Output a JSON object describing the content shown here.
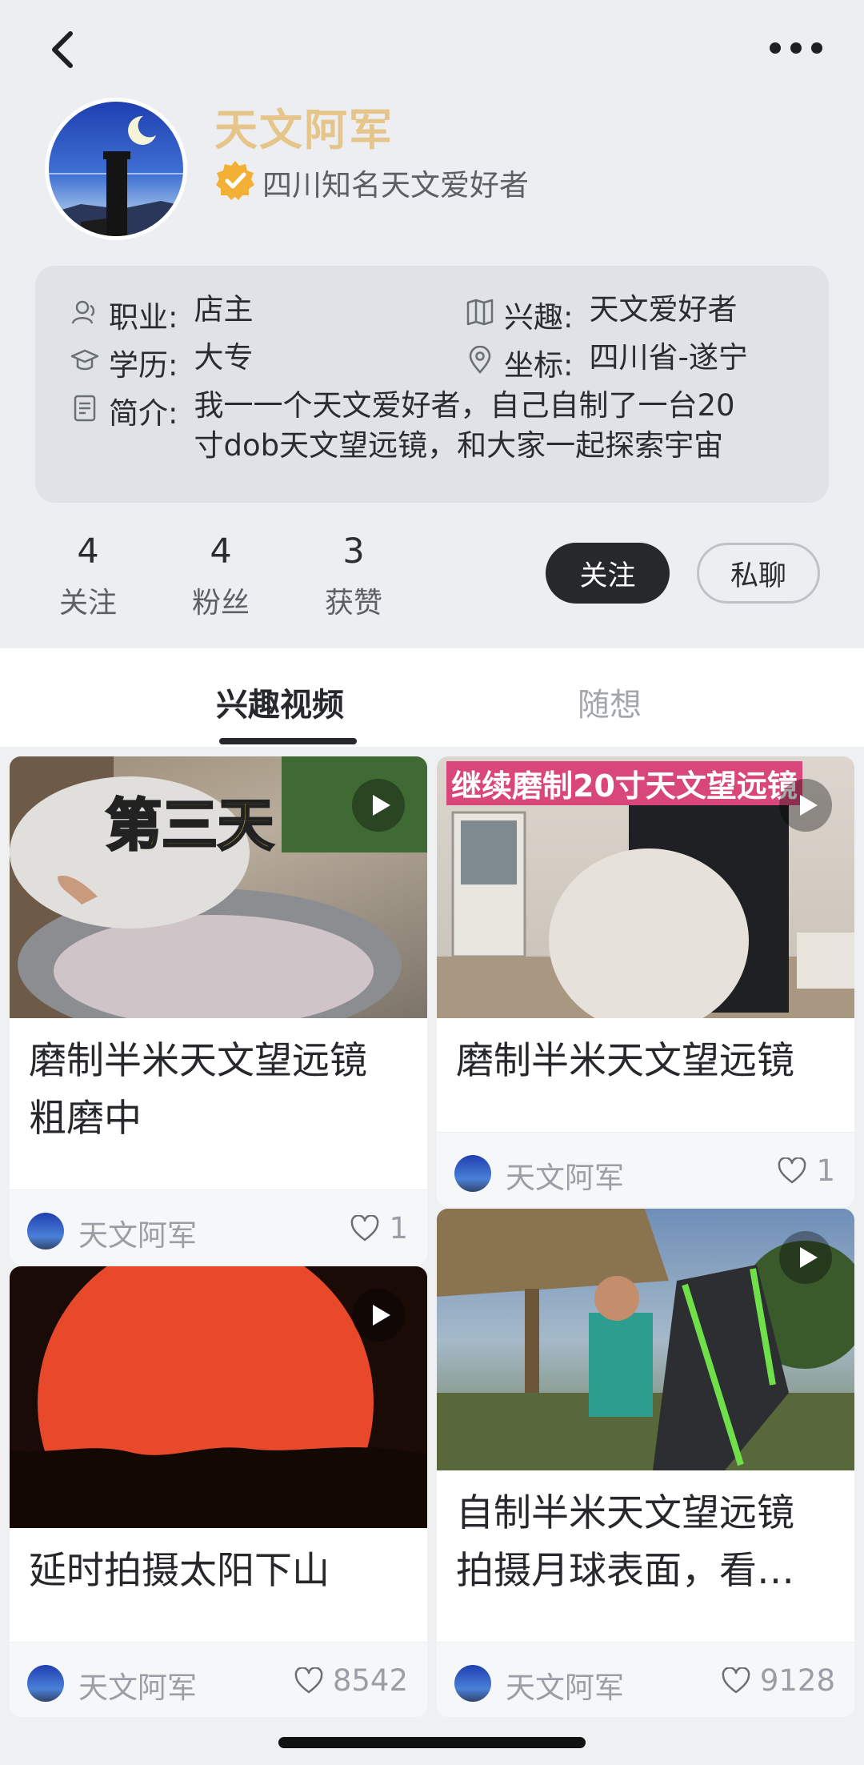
{
  "profile": {
    "name": "天文阿军",
    "verified_text": "四川知名天文爱好者"
  },
  "info": {
    "job_label": "职业:",
    "job_value": "店主",
    "interest_label": "兴趣:",
    "interest_value": "天文爱好者",
    "education_label": "学历:",
    "education_value": "大专",
    "location_label": "坐标:",
    "location_value": "四川省-遂宁",
    "bio_label": "简介:",
    "bio_line1": "我一一个天文爱好者，自己自制了一台20",
    "bio_line2": "寸dob天文望远镜，和大家一起探索宇宙"
  },
  "stats": [
    {
      "num": "4",
      "label": "关注"
    },
    {
      "num": "4",
      "label": "粉丝"
    },
    {
      "num": "3",
      "label": "获赞"
    }
  ],
  "actions": {
    "follow": "关注",
    "chat": "私聊"
  },
  "tabs": [
    {
      "label": "兴趣视频",
      "active": true
    },
    {
      "label": "随想",
      "active": false
    }
  ],
  "cards": [
    {
      "title_line1": "磨制半米天文望远镜",
      "title_line2": "粗磨中",
      "overlay": "第三天",
      "author": "天文阿军",
      "likes": "1"
    },
    {
      "title_line1": "磨制半米天文望远镜",
      "title_line2": "",
      "overlay": "继续磨制20寸天文望远镜",
      "author": "天文阿军",
      "likes": "1"
    },
    {
      "title_line1": "延时拍摄太阳下山",
      "title_line2": "",
      "overlay": "",
      "author": "天文阿军",
      "likes": "8542"
    },
    {
      "title_line1": "自制半米天文望远镜",
      "title_line2": "拍摄月球表面，看…",
      "overlay": "",
      "author": "天文阿军",
      "likes": "9128"
    }
  ],
  "colors": {
    "name": "#e6c58a",
    "dark_button": "#26282b",
    "verify_badge": "#f2b135"
  }
}
